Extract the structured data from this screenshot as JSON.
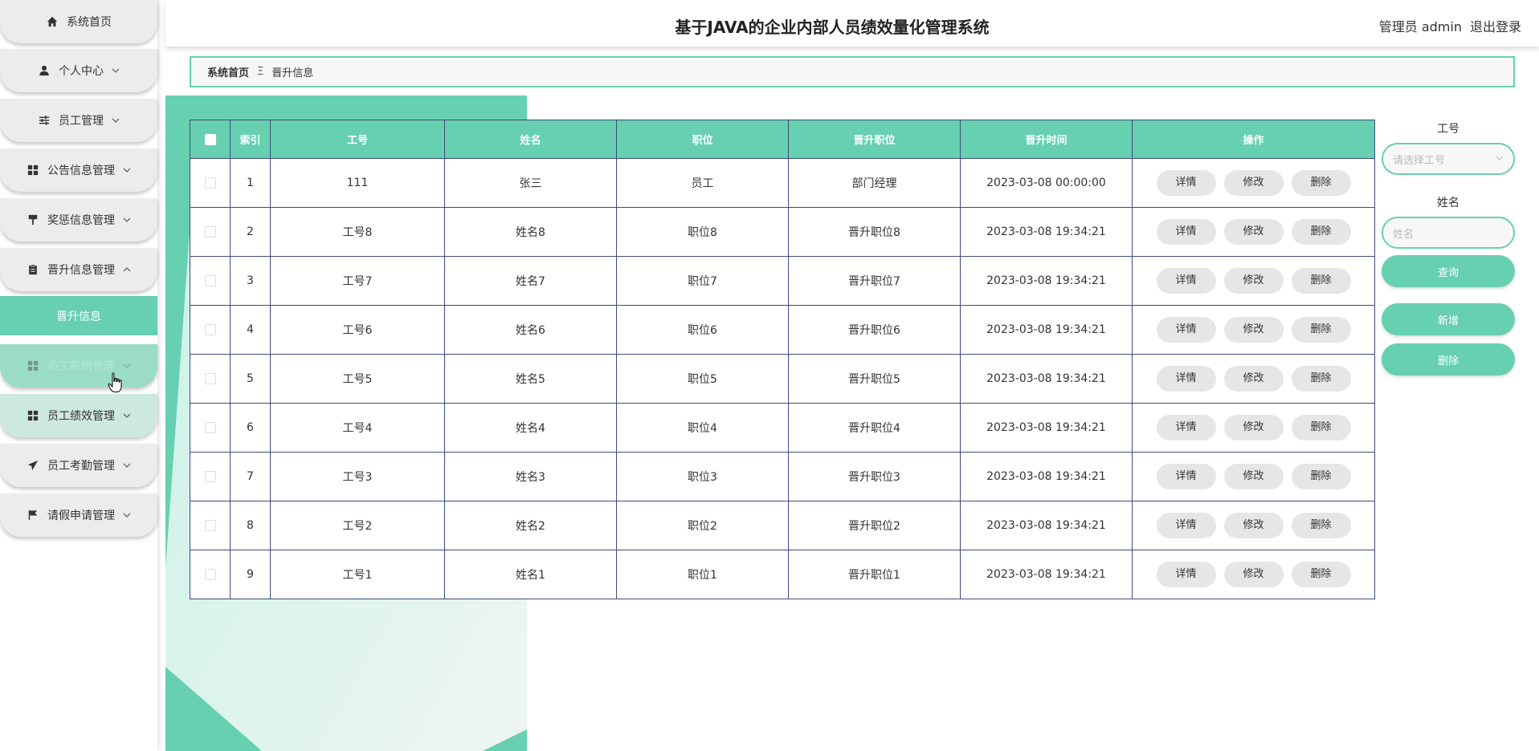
{
  "colors": {
    "accent": "#66d0b0",
    "row_border": "#3f4b7a",
    "menu_bg": "#ececec"
  },
  "header": {
    "title": "基于JAVA的企业内部人员绩效量化管理系统",
    "user_role": "管理员 admin",
    "logout": "退出登录"
  },
  "sidebar": {
    "items": [
      {
        "label": "系统首页",
        "icon": "home-icon"
      },
      {
        "label": "个人中心",
        "icon": "person-icon"
      },
      {
        "label": "员工管理",
        "icon": "sliders-icon"
      },
      {
        "label": "公告信息管理",
        "icon": "grid-icon"
      },
      {
        "label": "奖惩信息管理",
        "icon": "paint-roller-icon"
      },
      {
        "label": "晋升信息管理",
        "icon": "clipboard-icon"
      },
      {
        "label": "员工薪酬管理",
        "icon": "grid-icon"
      },
      {
        "label": "员工绩效管理",
        "icon": "grid-icon"
      },
      {
        "label": "员工考勤管理",
        "icon": "send-icon"
      },
      {
        "label": "请假申请管理",
        "icon": "flag-icon"
      }
    ],
    "submenu": {
      "label": "晋升信息"
    }
  },
  "breadcrumb": {
    "home": "系统首页",
    "separator": "Ξ",
    "current": "晋升信息"
  },
  "table": {
    "headers": [
      "索引",
      "工号",
      "姓名",
      "职位",
      "晋升职位",
      "晋升时间",
      "操作"
    ],
    "rows": [
      {
        "index": "1",
        "job_no": "111",
        "name": "张三",
        "position": "员工",
        "promoted_position": "部门经理",
        "promotion_time": "2023-03-08 00:00:00"
      },
      {
        "index": "2",
        "job_no": "工号8",
        "name": "姓名8",
        "position": "职位8",
        "promoted_position": "晋升职位8",
        "promotion_time": "2023-03-08 19:34:21"
      },
      {
        "index": "3",
        "job_no": "工号7",
        "name": "姓名7",
        "position": "职位7",
        "promoted_position": "晋升职位7",
        "promotion_time": "2023-03-08 19:34:21"
      },
      {
        "index": "4",
        "job_no": "工号6",
        "name": "姓名6",
        "position": "职位6",
        "promoted_position": "晋升职位6",
        "promotion_time": "2023-03-08 19:34:21"
      },
      {
        "index": "5",
        "job_no": "工号5",
        "name": "姓名5",
        "position": "职位5",
        "promoted_position": "晋升职位5",
        "promotion_time": "2023-03-08 19:34:21"
      },
      {
        "index": "6",
        "job_no": "工号4",
        "name": "姓名4",
        "position": "职位4",
        "promoted_position": "晋升职位4",
        "promotion_time": "2023-03-08 19:34:21"
      },
      {
        "index": "7",
        "job_no": "工号3",
        "name": "姓名3",
        "position": "职位3",
        "promoted_position": "晋升职位3",
        "promotion_time": "2023-03-08 19:34:21"
      },
      {
        "index": "8",
        "job_no": "工号2",
        "name": "姓名2",
        "position": "职位2",
        "promoted_position": "晋升职位2",
        "promotion_time": "2023-03-08 19:34:21"
      },
      {
        "index": "9",
        "job_no": "工号1",
        "name": "姓名1",
        "position": "职位1",
        "promoted_position": "晋升职位1",
        "promotion_time": "2023-03-08 19:34:21"
      }
    ],
    "actions": {
      "detail": "详情",
      "edit": "修改",
      "delete": "删除"
    }
  },
  "search": {
    "job_no_label": "工号",
    "job_no_placeholder": "请选择工号",
    "name_label": "姓名",
    "name_placeholder": "姓名",
    "query_button": "查询",
    "add_button": "新增",
    "delete_button": "删除"
  }
}
